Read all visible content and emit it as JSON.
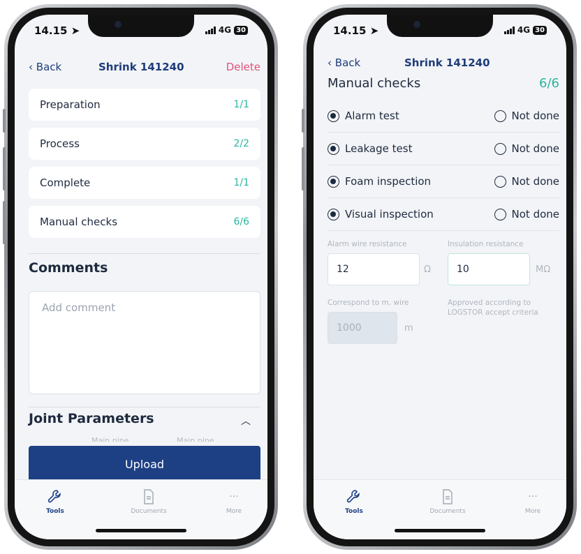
{
  "status": {
    "time": "14.15",
    "network": "4G",
    "battery": "30"
  },
  "left": {
    "back_label": "Back",
    "title": "Shrink 141240",
    "delete_label": "Delete",
    "sections": [
      {
        "label": "Preparation",
        "count": "1/1"
      },
      {
        "label": "Process",
        "count": "2/2"
      },
      {
        "label": "Complete",
        "count": "1/1"
      },
      {
        "label": "Manual checks",
        "count": "6/6"
      }
    ],
    "comments_heading": "Comments",
    "comment_placeholder": "Add comment",
    "joint_heading": "Joint Parameters",
    "faint_col_1": "Main pipe",
    "faint_col_2": "Main pipe",
    "upload_label": "Upload"
  },
  "right": {
    "back_label": "Back",
    "title": "Shrink 141240",
    "checks_heading": "Manual checks",
    "checks_count": "6/6",
    "checks": [
      {
        "label": "Alarm test",
        "alt": "Not done",
        "selected": "done"
      },
      {
        "label": "Leakage test",
        "alt": "Not done",
        "selected": "done"
      },
      {
        "label": "Foam inspection",
        "alt": "Not done",
        "selected": "done"
      },
      {
        "label": "Visual inspection",
        "alt": "Not done",
        "selected": "done"
      }
    ],
    "alarm_wire_label": "Alarm wire resistance",
    "alarm_wire_value": "12",
    "alarm_wire_unit": "Ω",
    "insulation_label": "Insulation resistance",
    "insulation_value": "10",
    "insulation_unit": "MΩ",
    "correspond_label": "Correspond to m. wire",
    "correspond_value": "1000",
    "correspond_unit": "m",
    "approved_line1": "Approved according to",
    "approved_line2": "LOGSTOR accept criteria"
  },
  "tabs": [
    {
      "label": "Tools",
      "icon": "wrench-icon",
      "active": true
    },
    {
      "label": "Documents",
      "icon": "document-icon",
      "active": false
    },
    {
      "label": "More",
      "icon": "more-icon",
      "active": false
    }
  ],
  "colors": {
    "accent": "#1d3f84",
    "count_green": "#2bb59f",
    "delete_pink": "#e0507a"
  }
}
